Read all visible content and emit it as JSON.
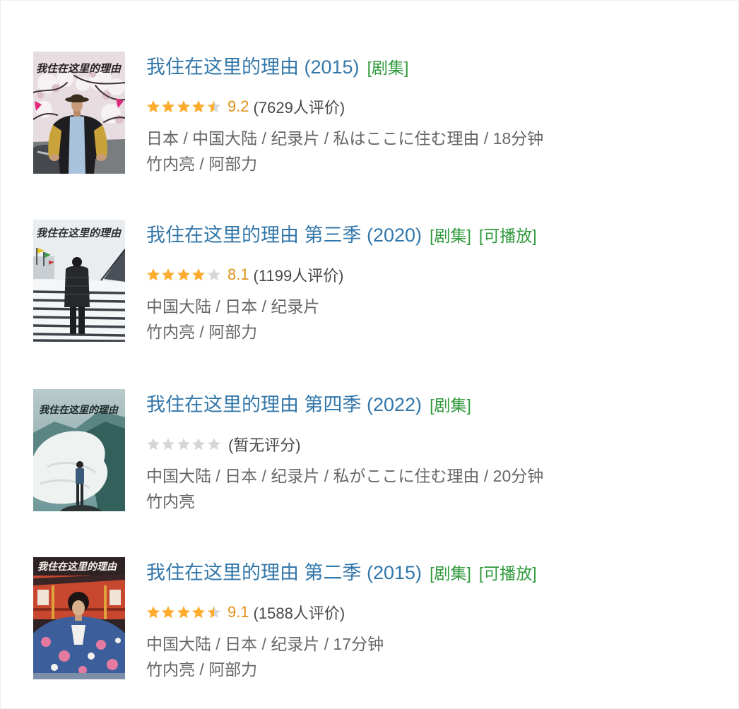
{
  "colors": {
    "title_link": "#3377aa",
    "tag": "#2f9a3c",
    "score": "#e09015",
    "star_filled": "#ffac2d",
    "star_empty": "#d6d6d6",
    "meta_text": "#666666"
  },
  "results": [
    {
      "title": "我住在这里的理由 (2015)",
      "tags": [
        "[剧集]"
      ],
      "rating": {
        "stars": 4.5,
        "score": "9.2",
        "count": "(7629人评价)"
      },
      "meta": "日本 / 中国大陆 / 纪录片 / 私はここに住む理由 / 18分钟",
      "cast": "竹内亮 / 阿部力",
      "poster": {
        "lettering": "我住在这里的理由"
      }
    },
    {
      "title": "我住在这里的理由 第三季 (2020)",
      "tags": [
        "[剧集]",
        "[可播放]"
      ],
      "rating": {
        "stars": 4,
        "score": "8.1",
        "count": "(1199人评价)"
      },
      "meta": "中国大陆 / 日本 / 纪录片",
      "cast": "竹内亮 / 阿部力",
      "poster": {
        "lettering": "我住在这里的理由"
      }
    },
    {
      "title": "我住在这里的理由 第四季 (2022)",
      "tags": [
        "[剧集]"
      ],
      "rating": {
        "stars": 0,
        "count": "(暂无评分)"
      },
      "meta": "中国大陆 / 日本 / 纪录片 / 私がここに住む理由 / 20分钟",
      "cast": "竹内亮",
      "poster": {
        "lettering": "我住在这里的理由"
      }
    },
    {
      "title": "我住在这里的理由 第二季 (2015)",
      "tags": [
        "[剧集]",
        "[可播放]"
      ],
      "rating": {
        "stars": 4.5,
        "score": "9.1",
        "count": "(1588人评价)"
      },
      "meta": "中国大陆 / 日本 / 纪录片 / 17分钟",
      "cast": "竹内亮 / 阿部力",
      "poster": {
        "lettering": "我住在这里的理由"
      }
    }
  ]
}
